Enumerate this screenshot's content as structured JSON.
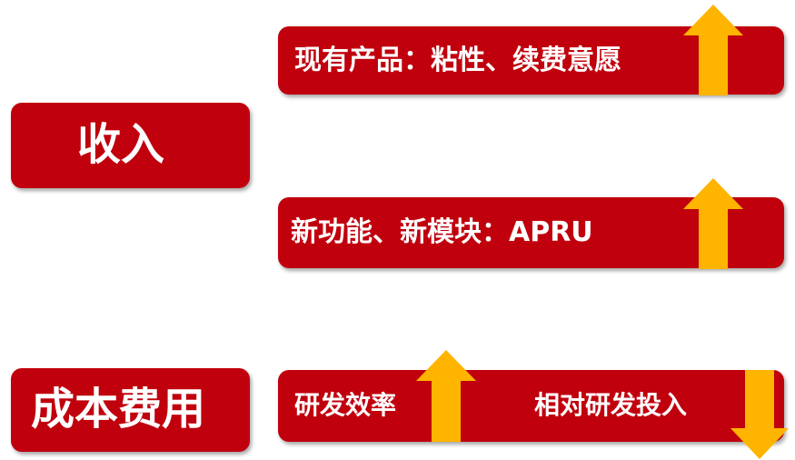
{
  "colors": {
    "box_red": "#c0000d",
    "arrow_yellow": "#ffb400",
    "text": "#ffffff"
  },
  "revenue": {
    "label": "收入",
    "items": [
      {
        "text": "现有产品：粘性、续费意愿",
        "arrow": "up-arrow-icon"
      },
      {
        "text": "新功能、新模块：APRU",
        "arrow": "up-arrow-icon"
      }
    ]
  },
  "cost": {
    "label": "成本费用",
    "items": [
      {
        "text": "研发效率",
        "arrow": "up-arrow-icon"
      },
      {
        "text": "相对研发投入",
        "arrow": "down-arrow-icon"
      }
    ]
  }
}
